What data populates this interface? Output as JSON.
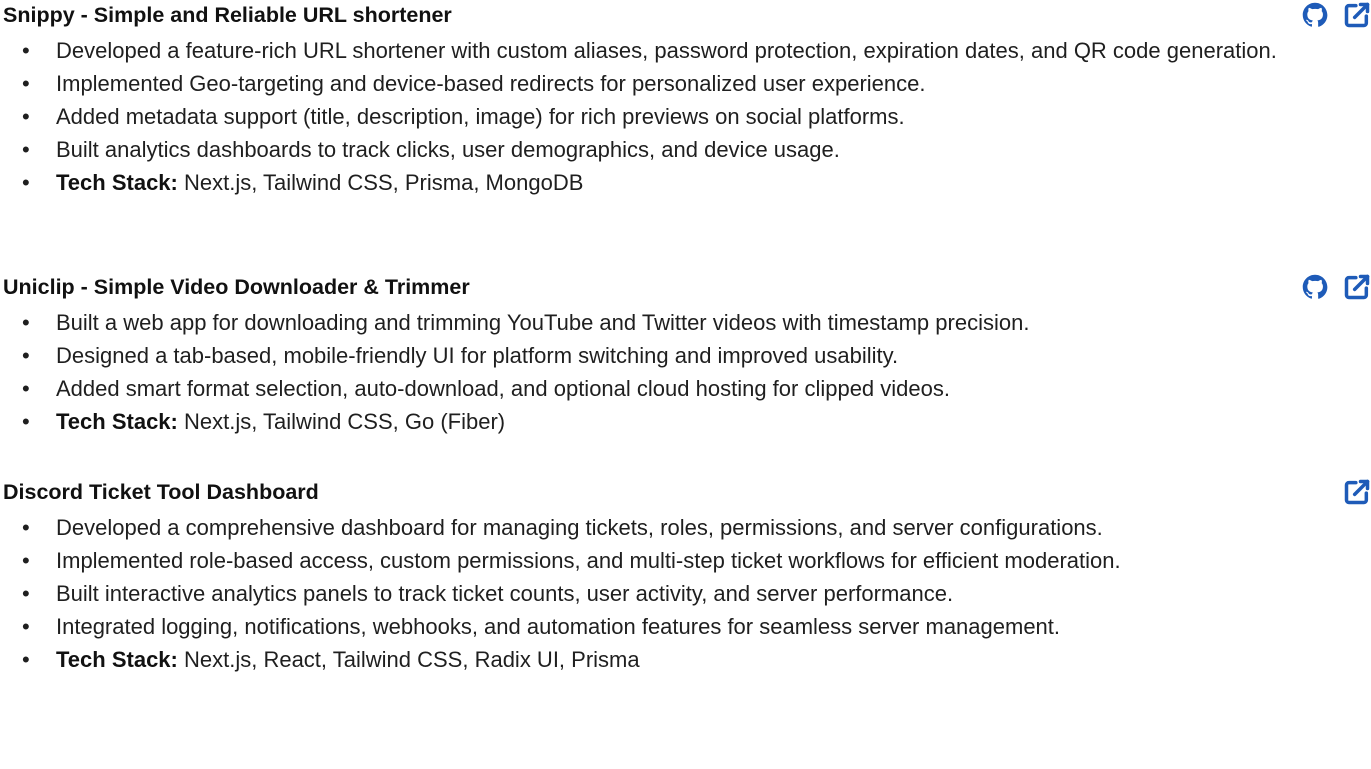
{
  "accent_color": "#1e5bb8",
  "projects": [
    {
      "title": "Snippy - Simple and Reliable URL shortener",
      "icons": [
        "github-icon",
        "external-link-icon"
      ],
      "bullets": [
        "Developed a feature-rich URL shortener with custom aliases, password protection, expiration dates, and QR code generation.",
        "Implemented Geo-targeting and device-based redirects for personalized user experience.",
        "Added metadata support (title, description, image) for rich previews on social platforms.",
        "Built analytics dashboards to track clicks, user demographics, and device usage."
      ],
      "tech_label": "Tech Stack:",
      "tech_value": "Next.js, Tailwind CSS, Prisma, MongoDB"
    },
    {
      "title": "Uniclip - Simple Video Downloader & Trimmer",
      "icons": [
        "github-icon",
        "external-link-icon"
      ],
      "bullets": [
        "Built a web app for downloading and trimming YouTube and Twitter videos with timestamp precision.",
        "Designed a tab-based, mobile-friendly UI for platform switching and improved usability.",
        "Added smart format selection, auto-download, and optional cloud hosting for clipped videos."
      ],
      "tech_label": "Tech Stack:",
      "tech_value": "Next.js, Tailwind CSS, Go (Fiber)"
    },
    {
      "title": "Discord Ticket Tool Dashboard",
      "icons": [
        "external-link-icon"
      ],
      "bullets": [
        "Developed a comprehensive dashboard for managing tickets, roles, permissions, and server configurations.",
        "Implemented role-based access, custom permissions, and multi-step ticket workflows for efficient moderation.",
        "Built interactive analytics panels to track ticket counts, user activity, and server performance.",
        "Integrated logging, notifications, webhooks, and automation features for seamless server management."
      ],
      "tech_label": "Tech Stack:",
      "tech_value": "Next.js, React, Tailwind CSS, Radix UI, Prisma"
    }
  ]
}
